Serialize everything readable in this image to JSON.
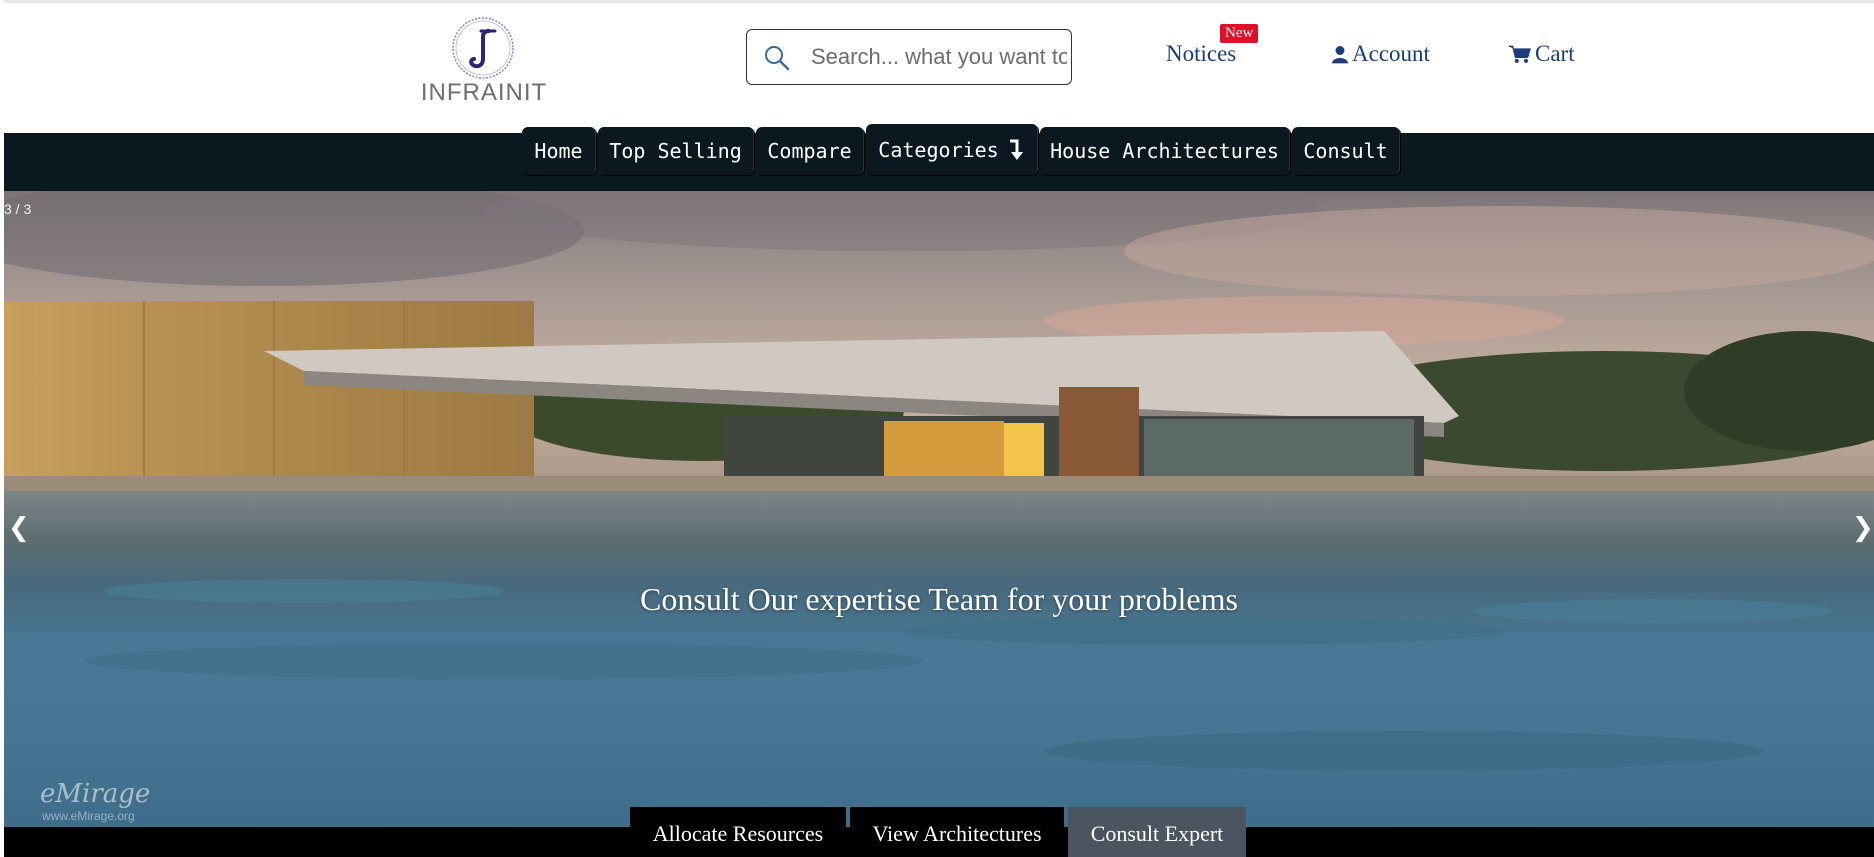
{
  "brand": {
    "logo_text": "INFRAINIT",
    "logo_letter": "J"
  },
  "search": {
    "placeholder": "Search... what you want to"
  },
  "header_nav": {
    "notices": "Notices",
    "notices_badge": "New",
    "account": "Account",
    "cart": "Cart"
  },
  "menu": {
    "items": [
      "Home",
      "Top Selling",
      "Compare",
      "Categories",
      "House Architectures",
      "Consult"
    ]
  },
  "hero": {
    "slide_counter": "3 / 3",
    "caption": "Consult Our expertise Team for your problems",
    "prev": "❮",
    "next": "❯",
    "watermark": "eMirage",
    "watermark_url": "www.eMirage.org"
  },
  "tabs": {
    "items": [
      "Allocate Resources",
      "View Architectures",
      "Consult Expert"
    ],
    "active": "Consult Expert"
  },
  "colors": {
    "nav_text": "#1c3d7a",
    "menubar": "#0c1820",
    "badge": "#e0102a",
    "active_tab": "#4a5560"
  },
  "icons": {
    "search": "search-icon",
    "account": "user-icon",
    "cart": "cart-icon",
    "categories": "arrow-down-icon"
  }
}
